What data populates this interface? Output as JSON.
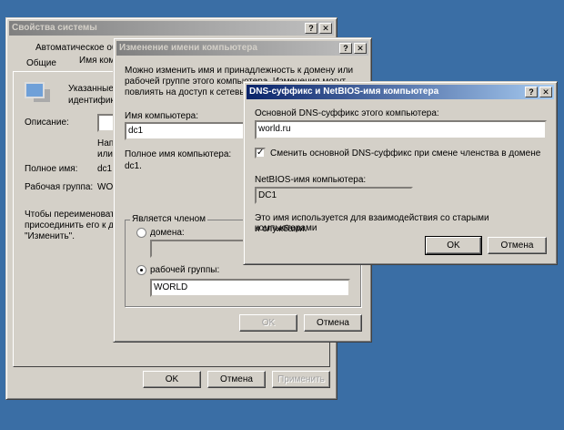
{
  "system_properties": {
    "title": "Свойства системы",
    "tab_top": "Автоматическое об",
    "tab_general": "Общие",
    "tab_name": "Имя ком",
    "desc_text1": "Указанные",
    "desc_text2": "идентифика",
    "description_label": "Описание:",
    "hint1": "Нап",
    "hint2": "или",
    "full_name_label": "Полное имя:",
    "full_name_value": "dc1.",
    "workgroup_label": "Рабочая группа:",
    "workgroup_value": "WOI",
    "rename_text1": "Чтобы переименовать",
    "rename_text2": "присоединить его к дс",
    "rename_text3": "\"Изменить\".",
    "ok": "OK",
    "cancel": "Отмена",
    "apply": "Применить"
  },
  "rename_dialog": {
    "title": "Изменение имени компьютера",
    "intro1": "Можно изменить имя и принадлежность к домену или",
    "intro2": "рабочей группе этого компьютера. Изменения могут",
    "intro3": "повлиять на доступ к сетевы",
    "computer_name_label": "Имя компьютера:",
    "computer_name_value": "dc1",
    "full_name_label": "Полное имя компьютера:",
    "full_name_value": "dc1.",
    "member_of": "Является членом",
    "domain_label": "домена:",
    "domain_value": "",
    "workgroup_label": "рабочей группы:",
    "workgroup_value": "WORLD",
    "selected": "workgroup",
    "ok": "OK",
    "cancel": "Отмена"
  },
  "dns_dialog": {
    "title": "DNS-суффикс и NetBIOS-имя компьютера",
    "suffix_label": "Основной DNS-суффикс этого компьютера:",
    "suffix_value": "world.ru",
    "change_checkbox": "Сменить основной DNS-суффикс при смене членства в домене",
    "change_checked": true,
    "netbios_label": "NetBIOS-имя компьютера:",
    "netbios_value": "DC1",
    "note1": "Это имя используется для взаимодействия со старыми компьютерами",
    "note2": "и службами.",
    "ok": "OK",
    "cancel": "Отмена"
  }
}
